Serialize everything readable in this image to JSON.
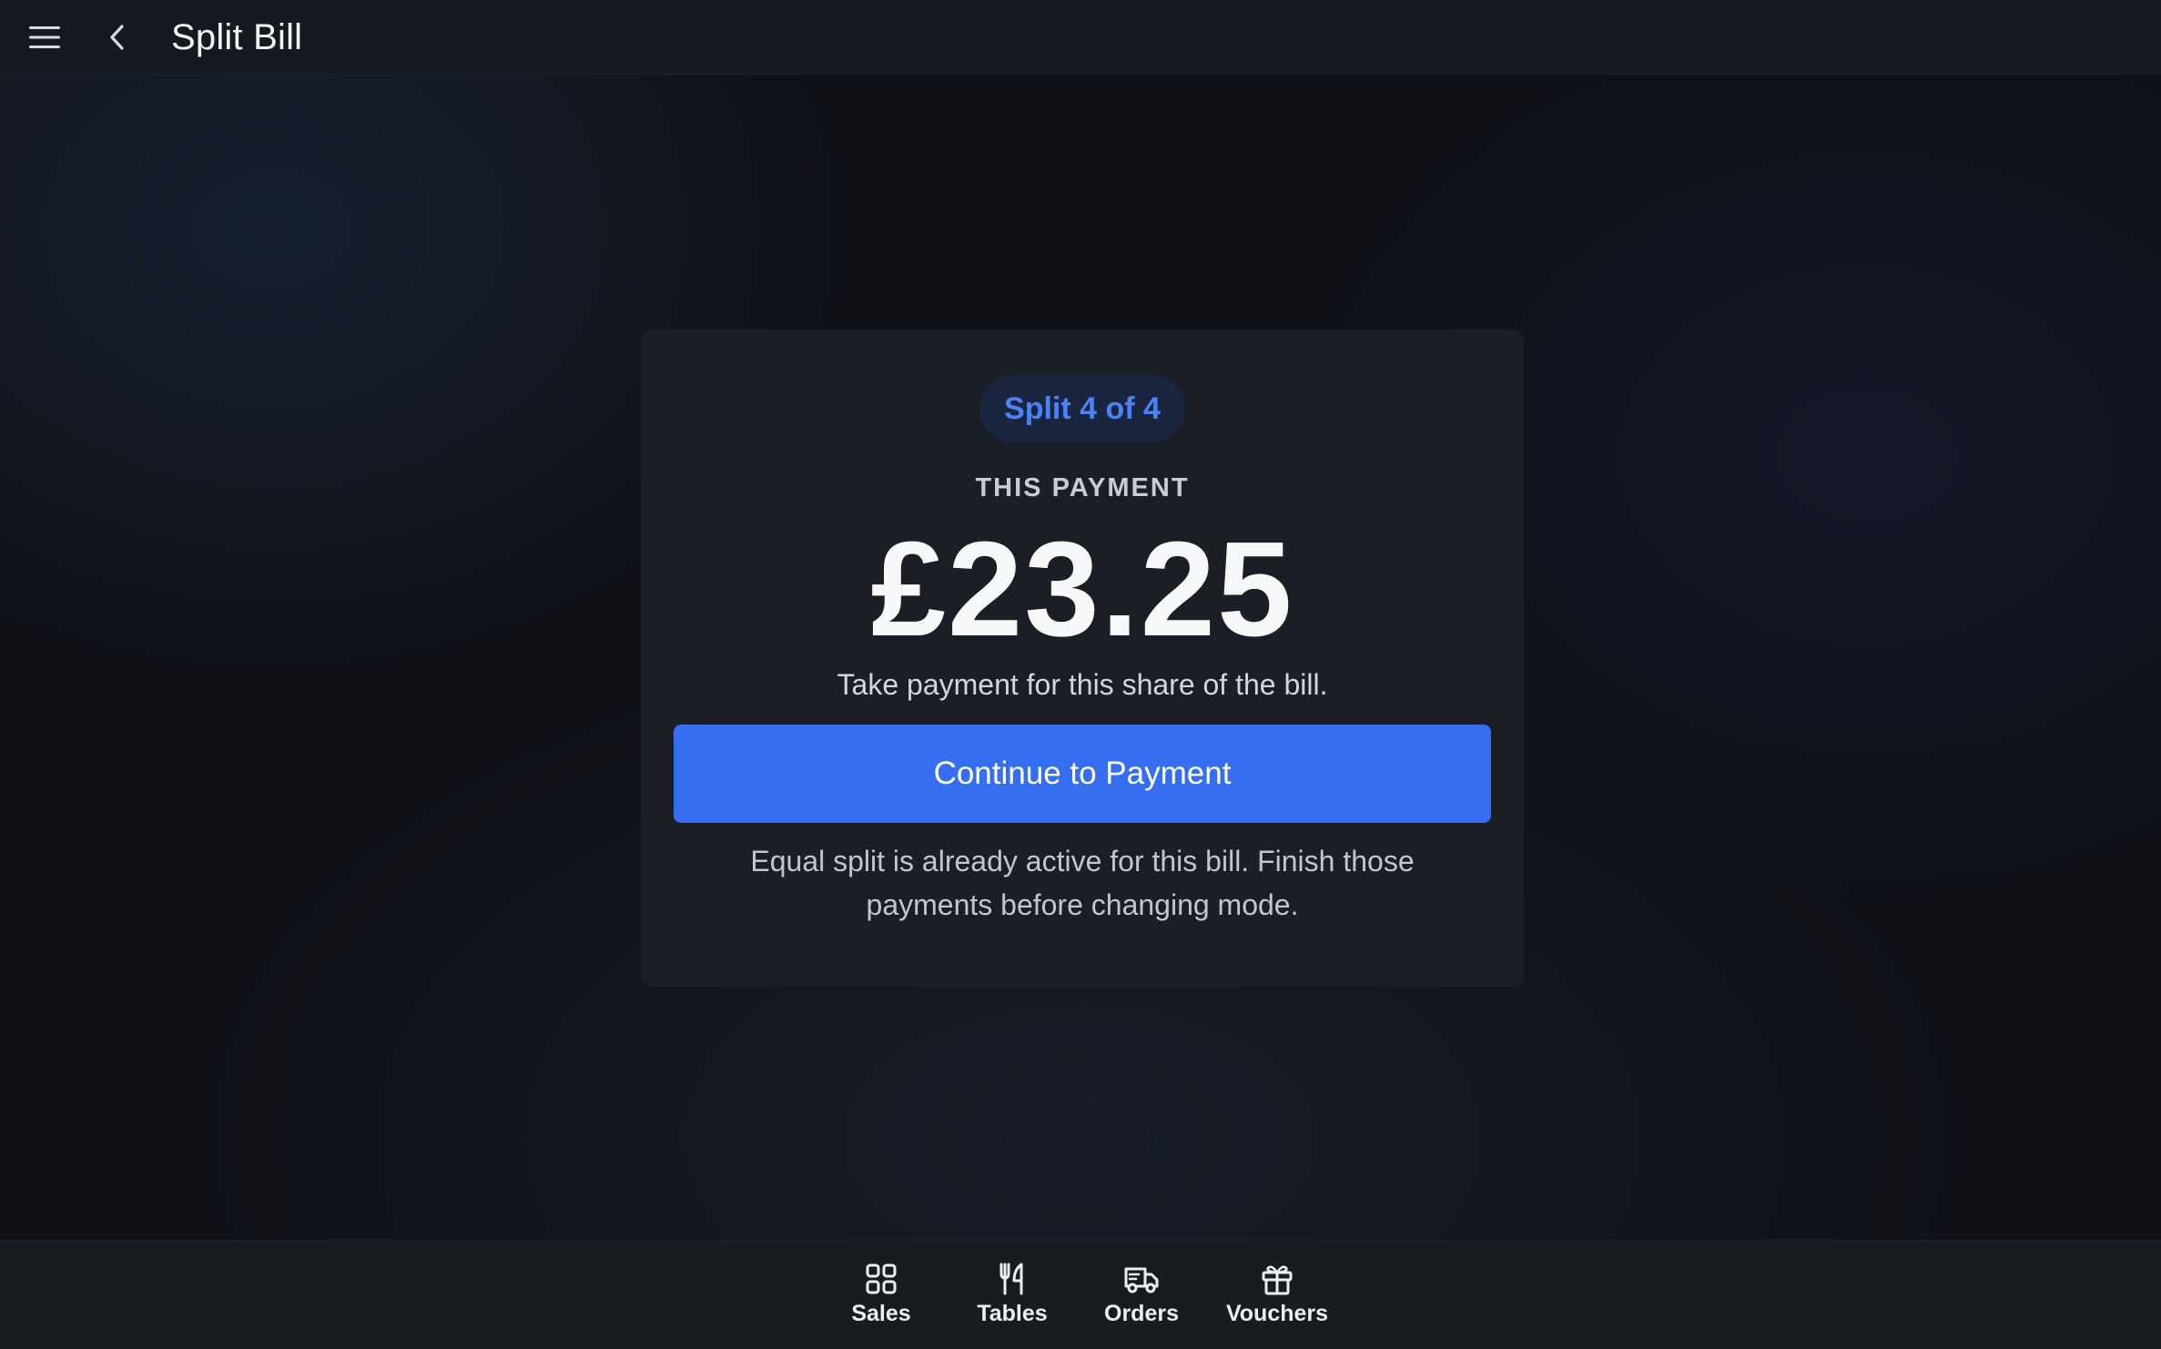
{
  "header": {
    "title": "Split Bill",
    "menu_icon": "hamburger-menu-icon",
    "back_icon": "chevron-left-icon"
  },
  "payment": {
    "split_badge": "Split 4 of 4",
    "label": "THIS PAYMENT",
    "amount": "£23.25",
    "instruction": "Take payment for this share of the bill.",
    "continue_label": "Continue to Payment",
    "notice": "Equal split is already active for this bill. Finish those payments before changing mode."
  },
  "bottom_nav": {
    "items": [
      {
        "label": "Sales",
        "icon": "grid-icon"
      },
      {
        "label": "Tables",
        "icon": "fork-knife-icon"
      },
      {
        "label": "Orders",
        "icon": "delivery-truck-icon"
      },
      {
        "label": "Vouchers",
        "icon": "gift-icon"
      }
    ]
  },
  "colors": {
    "background": "#0f1117",
    "card": "#1b1e24",
    "accent": "#366ef2",
    "badge_text": "#4d82f5",
    "badge_bg": "#1a2640"
  }
}
